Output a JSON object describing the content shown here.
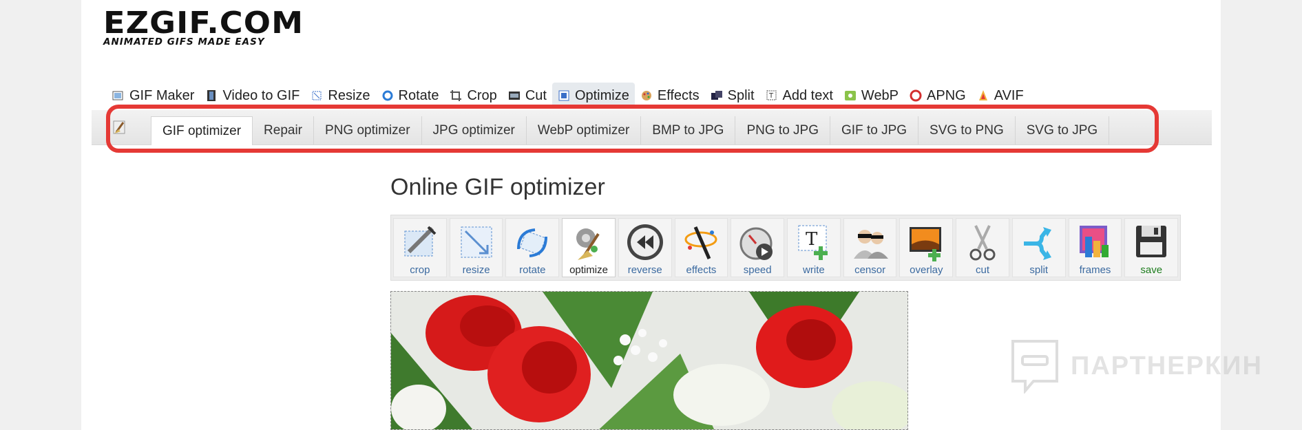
{
  "logo": {
    "main": "EZGIF.COM",
    "tagline": "ANIMATED GIFS MADE EASY"
  },
  "mainnav": [
    {
      "label": "GIF Maker",
      "icon": "gif-maker-icon"
    },
    {
      "label": "Video to GIF",
      "icon": "video-icon"
    },
    {
      "label": "Resize",
      "icon": "resize-icon"
    },
    {
      "label": "Rotate",
      "icon": "rotate-icon"
    },
    {
      "label": "Crop",
      "icon": "crop-icon"
    },
    {
      "label": "Cut",
      "icon": "cut-icon"
    },
    {
      "label": "Optimize",
      "icon": "optimize-icon",
      "active": true
    },
    {
      "label": "Effects",
      "icon": "effects-icon"
    },
    {
      "label": "Split",
      "icon": "split-icon"
    },
    {
      "label": "Add text",
      "icon": "add-text-icon"
    },
    {
      "label": "WebP",
      "icon": "webp-icon"
    },
    {
      "label": "APNG",
      "icon": "apng-icon"
    },
    {
      "label": "AVIF",
      "icon": "avif-icon"
    }
  ],
  "subnav": [
    {
      "label": "GIF optimizer",
      "active": true
    },
    {
      "label": "Repair"
    },
    {
      "label": "PNG optimizer"
    },
    {
      "label": "JPG optimizer"
    },
    {
      "label": "WebP optimizer"
    },
    {
      "label": "BMP to JPG"
    },
    {
      "label": "PNG to JPG"
    },
    {
      "label": "GIF to JPG"
    },
    {
      "label": "SVG to PNG"
    },
    {
      "label": "SVG to JPG"
    }
  ],
  "page_title": "Online GIF optimizer",
  "toolbar": [
    {
      "label": "crop",
      "icon": "crop-tool-icon"
    },
    {
      "label": "resize",
      "icon": "resize-tool-icon"
    },
    {
      "label": "rotate",
      "icon": "rotate-tool-icon"
    },
    {
      "label": "optimize",
      "icon": "optimize-tool-icon",
      "active": true
    },
    {
      "label": "reverse",
      "icon": "reverse-tool-icon"
    },
    {
      "label": "effects",
      "icon": "effects-tool-icon"
    },
    {
      "label": "speed",
      "icon": "speed-tool-icon"
    },
    {
      "label": "write",
      "icon": "write-tool-icon"
    },
    {
      "label": "censor",
      "icon": "censor-tool-icon"
    },
    {
      "label": "overlay",
      "icon": "overlay-tool-icon"
    },
    {
      "label": "cut",
      "icon": "cut-tool-icon"
    },
    {
      "label": "split",
      "icon": "split-tool-icon"
    },
    {
      "label": "frames",
      "icon": "frames-tool-icon"
    },
    {
      "label": "save",
      "icon": "save-tool-icon"
    }
  ],
  "watermark": {
    "text": "ПАРТНЕРКИН"
  },
  "colors": {
    "highlight": "#e53935",
    "tool_label": "#3b6aa0",
    "save_label": "#1e7d1e"
  }
}
